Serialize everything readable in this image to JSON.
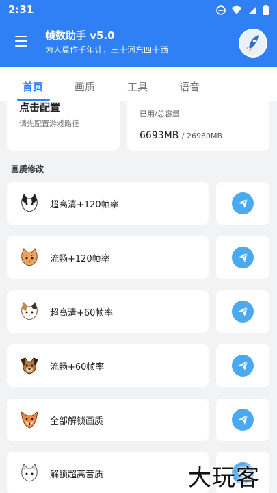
{
  "status": {
    "time": "2:31"
  },
  "header": {
    "title": "帧数助手 v5.0",
    "subtitle": "为人莫作千年计，三十河东四十西",
    "avatar_text": "帧数助手"
  },
  "tabs": [
    {
      "label": "首页",
      "active": true
    },
    {
      "label": "画质",
      "active": false
    },
    {
      "label": "工具",
      "active": false
    },
    {
      "label": "语音",
      "active": false
    }
  ],
  "config": {
    "title": "点击配置",
    "subtitle": "请先配置游戏路径"
  },
  "storage": {
    "label": "已用/总容量",
    "used": "6693MB",
    "total": "/ 26960MB"
  },
  "quality_section": {
    "title": "画质修改",
    "items": [
      {
        "label": "超高清+120帧率",
        "icon": "black-white-cat-icon"
      },
      {
        "label": "流畅+120帧率",
        "icon": "orange-cat-icon"
      },
      {
        "label": "超高清+60帧率",
        "icon": "calico-cat-icon"
      },
      {
        "label": "流畅+60帧率",
        "icon": "dog-icon"
      },
      {
        "label": "全部解锁画质",
        "icon": "fox-icon"
      },
      {
        "label": "解锁超高音质",
        "icon": "white-cat-icon"
      }
    ]
  },
  "watermark": "大玩客",
  "colors": {
    "primary": "#2f80f5",
    "action": "#4aa9ef",
    "background": "#f2f3f5"
  }
}
